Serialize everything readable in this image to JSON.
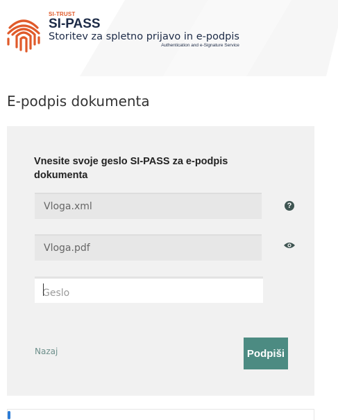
{
  "brand": {
    "small": "SI-TRUST",
    "title": "SI-PASS",
    "subtitle": "Storitev za spletno prijavo in e-podpis",
    "tagline": "Authentication and e-Signature Service"
  },
  "page": {
    "title": "E-podpis dokumenta"
  },
  "form": {
    "heading": "Vnesite svoje geslo SI-PASS za e-podpis dokumenta",
    "files": [
      "Vloga.xml",
      "Vloga.pdf"
    ],
    "password_placeholder": "Geslo",
    "password_value": "",
    "back_label": "Nazaj",
    "sign_label": "Podpiši"
  },
  "icons": {
    "logo": "si-pass-fingerprint-logo",
    "help": "question-icon",
    "preview": "eye-icon"
  },
  "colors": {
    "brand_orange": "#e05a2a",
    "primary_button": "#4c8b82",
    "link": "#6d8f8b",
    "navy": "#1c2a46"
  }
}
